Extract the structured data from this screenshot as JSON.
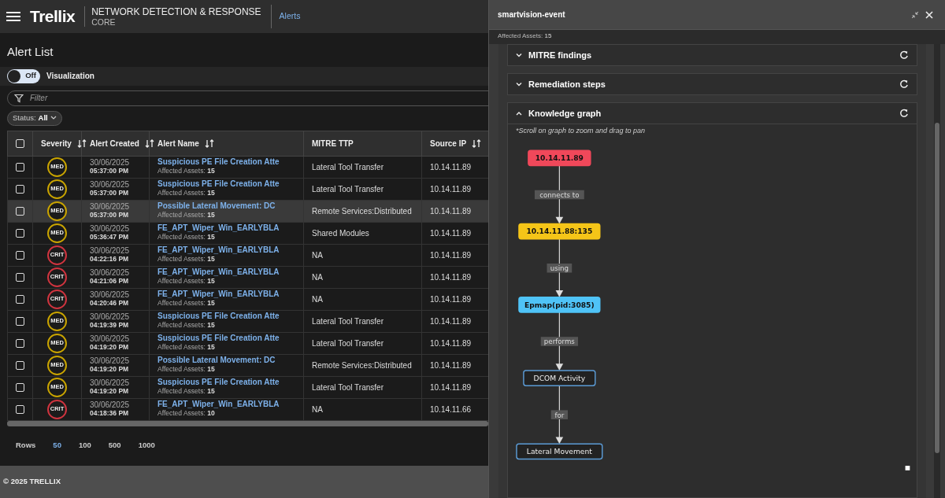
{
  "header": {
    "logo": "Trellix",
    "product": "NETWORK DETECTION & RESPONSE",
    "edition": "CORE",
    "breadcrumb": "Alerts"
  },
  "page_title": "Alert List",
  "visualization": {
    "toggle_label": "Off",
    "on": false,
    "label": "Visualization"
  },
  "filter": {
    "placeholder": "Filter"
  },
  "status_filter": {
    "label": "Status:",
    "value": "All"
  },
  "table": {
    "select_all_checked": false,
    "columns": [
      {
        "label": "Severity",
        "sortable": true
      },
      {
        "label": "Alert Created",
        "sortable": true
      },
      {
        "label": "Alert Name",
        "sortable": true
      },
      {
        "label": "MITRE TTP",
        "sortable": false
      },
      {
        "label": "Source IP",
        "sortable": true
      }
    ],
    "rows": [
      {
        "checked": false,
        "selected": false,
        "severity": "MED",
        "color": "#c9a400",
        "date": "30/06/2025",
        "time": "05:37:00 PM",
        "name": "Suspicious PE File Creation Atte",
        "assets_label": "Affected Assets:",
        "assets": "15",
        "mitre": "Lateral Tool Transfer",
        "source_ip": "10.14.11.89"
      },
      {
        "checked": false,
        "selected": false,
        "severity": "MED",
        "color": "#c9a400",
        "date": "30/06/2025",
        "time": "05:37:00 PM",
        "name": "Suspicious PE File Creation Atte",
        "assets_label": "Affected Assets:",
        "assets": "15",
        "mitre": "Lateral Tool Transfer",
        "source_ip": "10.14.11.89"
      },
      {
        "checked": false,
        "selected": true,
        "severity": "MED",
        "color": "#c9a400",
        "date": "30/06/2025",
        "time": "05:37:00 PM",
        "name": "Possible Lateral Movement: DC",
        "assets_label": "Affected Assets:",
        "assets": "15",
        "mitre": "Remote Services:Distributed",
        "source_ip": "10.14.11.89"
      },
      {
        "checked": false,
        "selected": false,
        "severity": "MED",
        "color": "#c9a400",
        "date": "30/06/2025",
        "time": "05:36:47 PM",
        "name": "FE_APT_Wiper_Win_EARLYBLA",
        "assets_label": "Affected Assets:",
        "assets": "15",
        "mitre": "Shared Modules",
        "source_ip": "10.14.11.89"
      },
      {
        "checked": false,
        "selected": false,
        "severity": "CRIT",
        "color": "#d0343f",
        "date": "30/06/2025",
        "time": "04:22:16 PM",
        "name": "FE_APT_Wiper_Win_EARLYBLA",
        "assets_label": "Affected Assets:",
        "assets": "15",
        "mitre": "NA",
        "source_ip": "10.14.11.89"
      },
      {
        "checked": false,
        "selected": false,
        "severity": "CRIT",
        "color": "#d0343f",
        "date": "30/06/2025",
        "time": "04:21:06 PM",
        "name": "FE_APT_Wiper_Win_EARLYBLA",
        "assets_label": "Affected Assets:",
        "assets": "15",
        "mitre": "NA",
        "source_ip": "10.14.11.89"
      },
      {
        "checked": false,
        "selected": false,
        "severity": "CRIT",
        "color": "#d0343f",
        "date": "30/06/2025",
        "time": "04:20:46 PM",
        "name": "FE_APT_Wiper_Win_EARLYBLA",
        "assets_label": "Affected Assets:",
        "assets": "15",
        "mitre": "NA",
        "source_ip": "10.14.11.89"
      },
      {
        "checked": false,
        "selected": false,
        "severity": "MED",
        "color": "#c9a400",
        "date": "30/06/2025",
        "time": "04:19:39 PM",
        "name": "Suspicious PE File Creation Atte",
        "assets_label": "Affected Assets:",
        "assets": "15",
        "mitre": "Lateral Tool Transfer",
        "source_ip": "10.14.11.89"
      },
      {
        "checked": false,
        "selected": false,
        "severity": "MED",
        "color": "#c9a400",
        "date": "30/06/2025",
        "time": "04:19:20 PM",
        "name": "Suspicious PE File Creation Atte",
        "assets_label": "Affected Assets:",
        "assets": "15",
        "mitre": "Lateral Tool Transfer",
        "source_ip": "10.14.11.89"
      },
      {
        "checked": false,
        "selected": false,
        "severity": "MED",
        "color": "#c9a400",
        "date": "30/06/2025",
        "time": "04:19:20 PM",
        "name": "Possible Lateral Movement: DC",
        "assets_label": "Affected Assets:",
        "assets": "15",
        "mitre": "Remote Services:Distributed",
        "source_ip": "10.14.11.89"
      },
      {
        "checked": false,
        "selected": false,
        "severity": "MED",
        "color": "#c9a400",
        "date": "30/06/2025",
        "time": "04:19:20 PM",
        "name": "Suspicious PE File Creation Atte",
        "assets_label": "Affected Assets:",
        "assets": "15",
        "mitre": "Lateral Tool Transfer",
        "source_ip": "10.14.11.89"
      },
      {
        "checked": false,
        "selected": false,
        "severity": "CRIT",
        "color": "#d0343f",
        "date": "30/06/2025",
        "time": "04:18:36 PM",
        "name": "FE_APT_Wiper_Win_EARLYBLA",
        "assets_label": "Affected Assets:",
        "assets": "10",
        "mitre": "NA",
        "source_ip": "10.14.11.66"
      }
    ]
  },
  "pagination": {
    "label": "Rows",
    "options": [
      {
        "label": "50",
        "selected": true
      },
      {
        "label": "100",
        "selected": false
      },
      {
        "label": "500",
        "selected": false
      },
      {
        "label": "1000",
        "selected": false
      }
    ]
  },
  "footer": "© 2025 TRELLIX",
  "panel": {
    "title": "smartvision-event",
    "subtitle_label": "Affected Assets:",
    "subtitle_value": "15",
    "sections": [
      {
        "title": "MITRE findings",
        "expanded": false
      },
      {
        "title": "Remediation steps",
        "expanded": false
      },
      {
        "title": "Knowledge graph",
        "expanded": true
      }
    ],
    "graph_hint": "*Scroll on graph to zoom and drag to pan",
    "graph": {
      "nodes": [
        {
          "label": "10.14.11.89",
          "kind": "filled",
          "color": "#f0485a"
        },
        {
          "label": "10.14.11.88:135",
          "kind": "filled",
          "color": "#f5c518"
        },
        {
          "label": "Epmap(pid:3085)",
          "kind": "filled",
          "color": "#4fc3f7"
        },
        {
          "label": "DCOM Activity",
          "kind": "outlined"
        },
        {
          "label": "Lateral Movement",
          "kind": "outlined"
        }
      ],
      "edges": [
        {
          "label": "connects to"
        },
        {
          "label": "using"
        },
        {
          "label": "performs"
        },
        {
          "label": "for"
        }
      ]
    }
  }
}
